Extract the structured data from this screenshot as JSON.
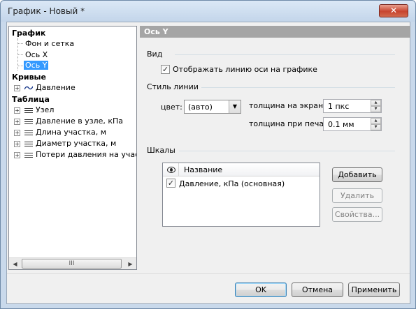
{
  "window": {
    "title": "График - Новый *",
    "close_glyph": "✕"
  },
  "tree": {
    "graph": {
      "label": "График",
      "children": [
        "Фон и сетка",
        "Ось X",
        "Ось Y"
      ]
    },
    "curves": {
      "label": "Кривые",
      "items": [
        "Давление"
      ]
    },
    "table": {
      "label": "Таблица",
      "items": [
        "Узел",
        "Давление в узле, кПа",
        "Длина участка, м",
        "Диаметр участка, м",
        "Потери давления на участке"
      ]
    },
    "scroll_thumb_glyph": "III"
  },
  "section": {
    "title": "Ось Y"
  },
  "view": {
    "label": "Вид",
    "show_axis_label": "Отображать линию оси на графике",
    "show_axis_checked": true
  },
  "line_style": {
    "label": "Стиль линии",
    "color_label": "цвет:",
    "color_value": "(авто)",
    "screen_width_label": "толщина на экране:",
    "screen_width_value": "1 пкс",
    "print_width_label": "толщина при печати:",
    "print_width_value": "0.1 мм"
  },
  "scales": {
    "label": "Шкалы",
    "column_name": "Название",
    "rows": [
      {
        "name": "Давление, кПа (основная)",
        "checked": true
      }
    ],
    "add_button": "Добавить",
    "delete_button": "Удалить",
    "properties_button": "Свойства..."
  },
  "footer": {
    "ok": "OK",
    "cancel": "Отмена",
    "apply": "Применить"
  },
  "colors": {
    "selection": "#3399ff",
    "header_bg": "#a5a5a5"
  }
}
